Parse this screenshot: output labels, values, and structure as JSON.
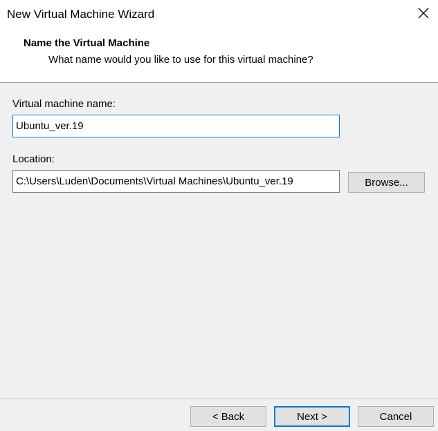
{
  "window": {
    "title": "New Virtual Machine Wizard",
    "close_icon": "close-icon"
  },
  "header": {
    "title": "Name the Virtual Machine",
    "subtitle": "What name would you like to use for this virtual machine?"
  },
  "form": {
    "name_label": "Virtual machine name:",
    "name_value": "Ubuntu_ver.19",
    "location_label": "Location:",
    "location_value": "C:\\Users\\Luden\\Documents\\Virtual Machines\\Ubuntu_ver.19",
    "browse_label": "Browse..."
  },
  "footer": {
    "back_label": "< Back",
    "next_label": "Next >",
    "cancel_label": "Cancel"
  },
  "colors": {
    "focus_accent": "#0078d7",
    "dialog_background": "#f0f0f0",
    "button_face": "#e1e1e1"
  }
}
